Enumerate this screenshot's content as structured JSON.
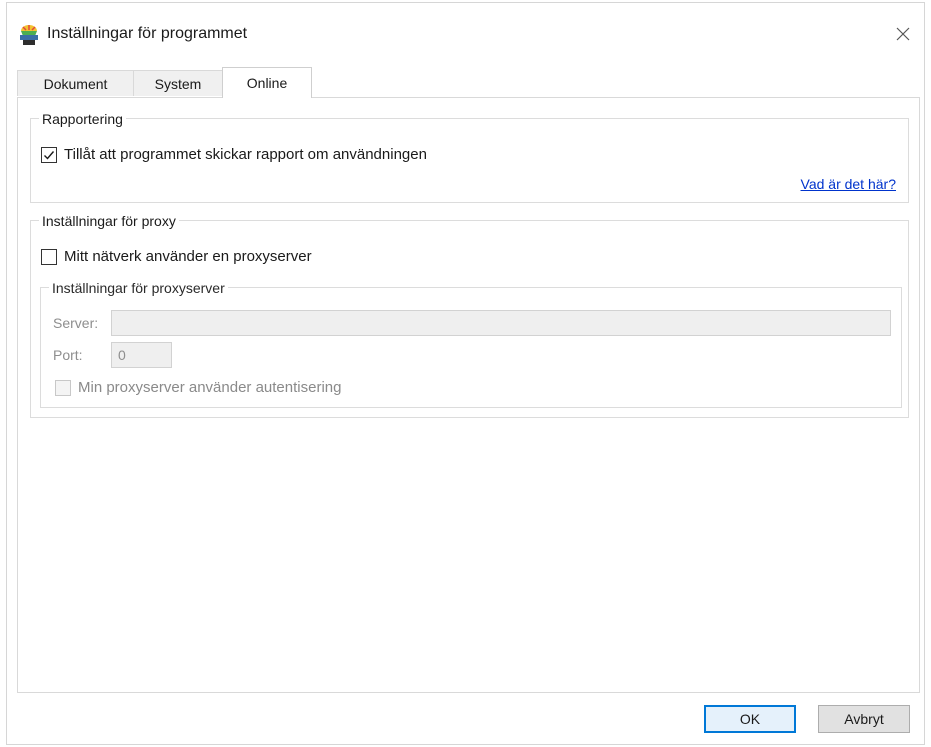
{
  "window": {
    "title": "Inställningar för programmet",
    "icon": "app-settings-icon",
    "close_icon": "close-icon"
  },
  "tabs": [
    {
      "label": "Dokument",
      "active": false
    },
    {
      "label": "System",
      "active": false
    },
    {
      "label": "Online",
      "active": true
    }
  ],
  "reporting": {
    "legend": "Rapportering",
    "checkbox_label": "Tillåt att programmet skickar rapport om användningen",
    "checked": true,
    "link": "Vad är det här?"
  },
  "proxy": {
    "legend": "Inställningar för proxy",
    "checkbox_label": "Mitt nätverk använder en proxyserver",
    "checked": false,
    "server_group": {
      "legend": "Inställningar för proxyserver",
      "server_label": "Server:",
      "server_value": "",
      "port_label": "Port:",
      "port_value": "0",
      "auth_label": "Min proxyserver använder autentisering",
      "auth_checked": false
    }
  },
  "buttons": {
    "ok": "OK",
    "cancel": "Avbryt"
  }
}
